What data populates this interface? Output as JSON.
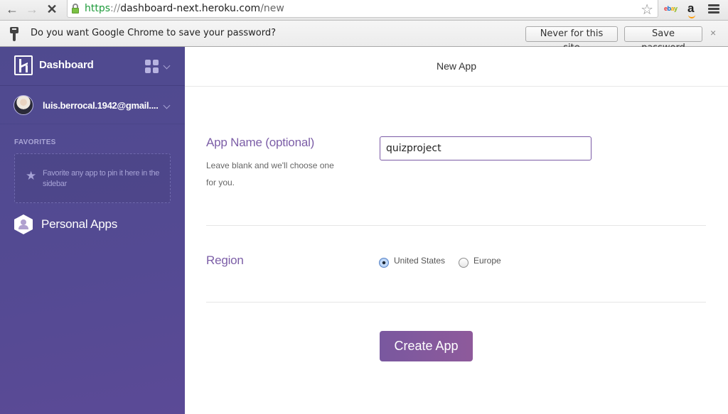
{
  "browser": {
    "url": {
      "scheme": "https",
      "separator": "://",
      "host": "dashboard-next.heroku.com",
      "path": "/new"
    },
    "icons": {
      "back": "←",
      "forward": "→",
      "stop": "✕",
      "bookmark_star": "☆",
      "infobar_close": "×"
    },
    "extensions": {
      "ebay": [
        "e",
        "b",
        "a",
        "y"
      ],
      "amazon": "a"
    },
    "infobar": {
      "message": "Do you want Google Chrome to save your password?",
      "never_label": "Never for this site",
      "save_label": "Save password"
    }
  },
  "sidebar": {
    "brand": "Dashboard",
    "account_email": "luis.berrocal.1942@gmail....",
    "favorites_title": "FAVORITES",
    "favorites_empty": "Favorite any app to pin it here in the sidebar",
    "favorites_star": "★",
    "personal_apps_label": "Personal Apps"
  },
  "main": {
    "title": "New App",
    "app_name": {
      "label": "App Name (optional)",
      "help": "Leave blank and we'll choose one for you.",
      "value": "quizproject"
    },
    "region": {
      "label": "Region",
      "options": [
        {
          "label": "United States",
          "selected": true
        },
        {
          "label": "Europe",
          "selected": false
        }
      ]
    },
    "create_label": "Create App"
  },
  "colors": {
    "sidebar_bg": "#544a93",
    "accent_purple": "#7c5ea7",
    "button_start": "#79589f",
    "button_end": "#8e5a9b"
  }
}
